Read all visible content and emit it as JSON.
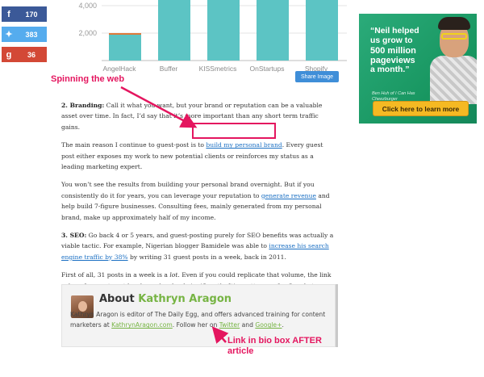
{
  "share": {
    "facebook": {
      "icon": "facebook-icon",
      "glyph": "f",
      "count": "170"
    },
    "twitter": {
      "icon": "twitter-icon",
      "glyph": "✦",
      "count": "383"
    },
    "googleplus": {
      "icon": "google-plus-icon",
      "glyph": "g",
      "count": "36"
    }
  },
  "chart_data": {
    "type": "bar",
    "categories": [
      "AngelHack",
      "Buffer",
      "KISSmetrics",
      "OnStartups",
      "Shopify"
    ],
    "values": [
      2000,
      4600,
      4600,
      4600,
      4600
    ],
    "yticks": [
      "4,000",
      "2,000"
    ],
    "ylim": [
      0,
      4600
    ],
    "bar_color": "#5cc4c4",
    "grid": true
  },
  "chart_button": "Share Image",
  "annotations": {
    "top": "Spinning the web",
    "bottom": "Link in bio box AFTER article"
  },
  "article": {
    "p1": {
      "label": "2. Branding:",
      "text": " Call it what you want, but your brand or reputation can be a valuable asset over time. In fact, I’d say that it’s more important than any short term traffic gains."
    },
    "p2": {
      "before": "The main reason I continue to guest-post is to ",
      "link": "build my personal brand",
      "after": ". Every guest post either exposes my work to new potential clients or reinforces my status as a leading marketing expert."
    },
    "p3": {
      "before": "You won’t see the results from building your personal brand overnight. But if you consistently do it for years, you can leverage your reputation to ",
      "link": "generate revenue",
      "after": " and help build 7-figure businesses. Consulting fees, mainly generated from my personal brand, make up approximately half of my income."
    },
    "p4": {
      "label": "3. SEO:",
      "before": " Go back 4 or 5 years, and guest-posting purely for SEO benefits was actually a viable tactic. For example, Nigerian blogger Bamidele was able to ",
      "link": "increase his search engine traffic by 38%",
      "after": " by writing 31 guest posts in a week, back in 2011."
    },
    "p5": {
      "before": "First of all, 31 posts in a week is a ",
      "em": "lot",
      "after": ". Even if you could replicate that volume, the link value of a guest post has been devalued significantly. It’s pretty easy for Google to identify the authorship of any given guest post, considering it’s usually in a bio box at the end of an article:"
    }
  },
  "bio": {
    "heading": "About ",
    "name": "Kathryn Aragon",
    "line1": "Kathryn Aragon is editor of The Daily Egg, and offers advanced training for content marketers at ",
    "link1": "KathrynAragon.com",
    "mid": ". Follow her on ",
    "link2": "Twitter",
    "and": " and ",
    "link3": "Google+",
    "end": "."
  },
  "ad": {
    "line1": "“Neil helped",
    "line2": "us grow to",
    "line3": "500 million",
    "line4": "pageviews",
    "line5": "a month.”",
    "quote": "Ben Huh of I Can Has Cheezburger",
    "cta": "Click here to learn more"
  }
}
